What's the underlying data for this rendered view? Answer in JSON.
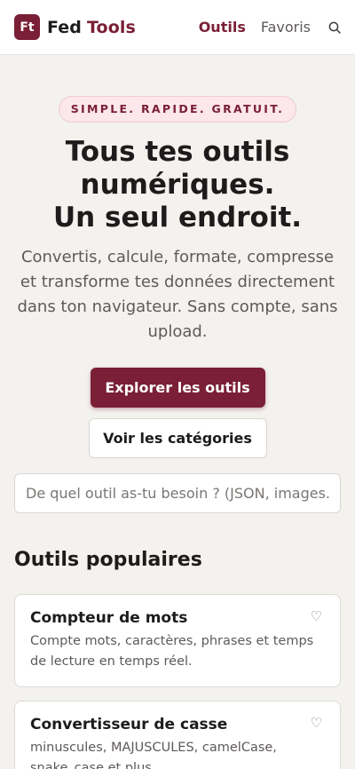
{
  "header": {
    "logo_text": "Ft",
    "brand_first": "Fed",
    "brand_second": "Tools",
    "nav": [
      {
        "label": "Outils",
        "active": true
      },
      {
        "label": "Favoris",
        "active": false
      }
    ],
    "search_icon": "search-icon"
  },
  "hero": {
    "badge": "SIMPLE. RAPIDE. GRATUIT.",
    "title_lines": [
      "Tous tes outils",
      "numériques.",
      "Un seul endroit."
    ],
    "subtitle": "Convertis, calcule, formate, compresse et transforme tes données directement dans ton navigateur. Sans compte, sans upload.",
    "primary_button": "Explorer les outils",
    "secondary_button": "Voir les catégories"
  },
  "search": {
    "placeholder": "De quel outil as-tu besoin ? (JSON, images...)",
    "value": ""
  },
  "popular": {
    "title": "Outils populaires",
    "tools": [
      {
        "name": "Compteur de mots",
        "desc": "Compte mots, caractères, phrases et temps de lecture en temps réel.",
        "icon": "heart-outline-icon"
      },
      {
        "name": "Convertisseur de casse",
        "desc": "minuscules, MAJUSCULES, camelCase, snake_case et plus.",
        "icon": "heart-outline-icon"
      }
    ]
  },
  "colors": {
    "accent": "#7a1f36",
    "background": "#f3f2ef",
    "badge_bg": "#fbe7ec"
  }
}
